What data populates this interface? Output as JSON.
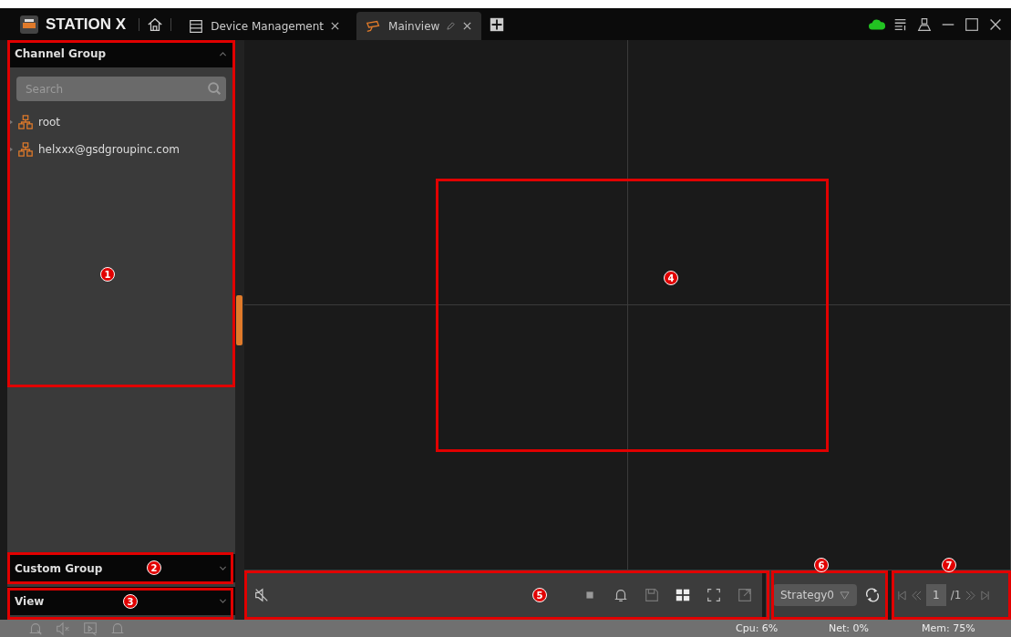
{
  "app": {
    "name": "STATION X"
  },
  "tabs": [
    {
      "label": "Device Management",
      "selected": false,
      "kind": "list"
    },
    {
      "label": "Mainview",
      "selected": true,
      "kind": "camera"
    }
  ],
  "sidebar": {
    "sections": [
      {
        "title": "Channel Group",
        "expanded": true
      },
      {
        "title": "Custom Group",
        "expanded": false
      },
      {
        "title": "View",
        "expanded": false
      }
    ],
    "search": {
      "placeholder": "Search"
    },
    "tree": [
      {
        "label": "root"
      },
      {
        "label": "helxxx@gsdgroupinc.com"
      }
    ]
  },
  "toolbar": {
    "strategy": "Strategy0",
    "page": "1",
    "page_total": "/1"
  },
  "status_bar": {
    "cpu": "Cpu: 6%",
    "net": "Net: 0%",
    "mem": "Mem: 75%"
  },
  "annotations": [
    {
      "label": "1"
    },
    {
      "label": "2"
    },
    {
      "label": "3"
    },
    {
      "label": "4"
    },
    {
      "label": "5"
    },
    {
      "label": "6"
    },
    {
      "label": "7"
    }
  ]
}
